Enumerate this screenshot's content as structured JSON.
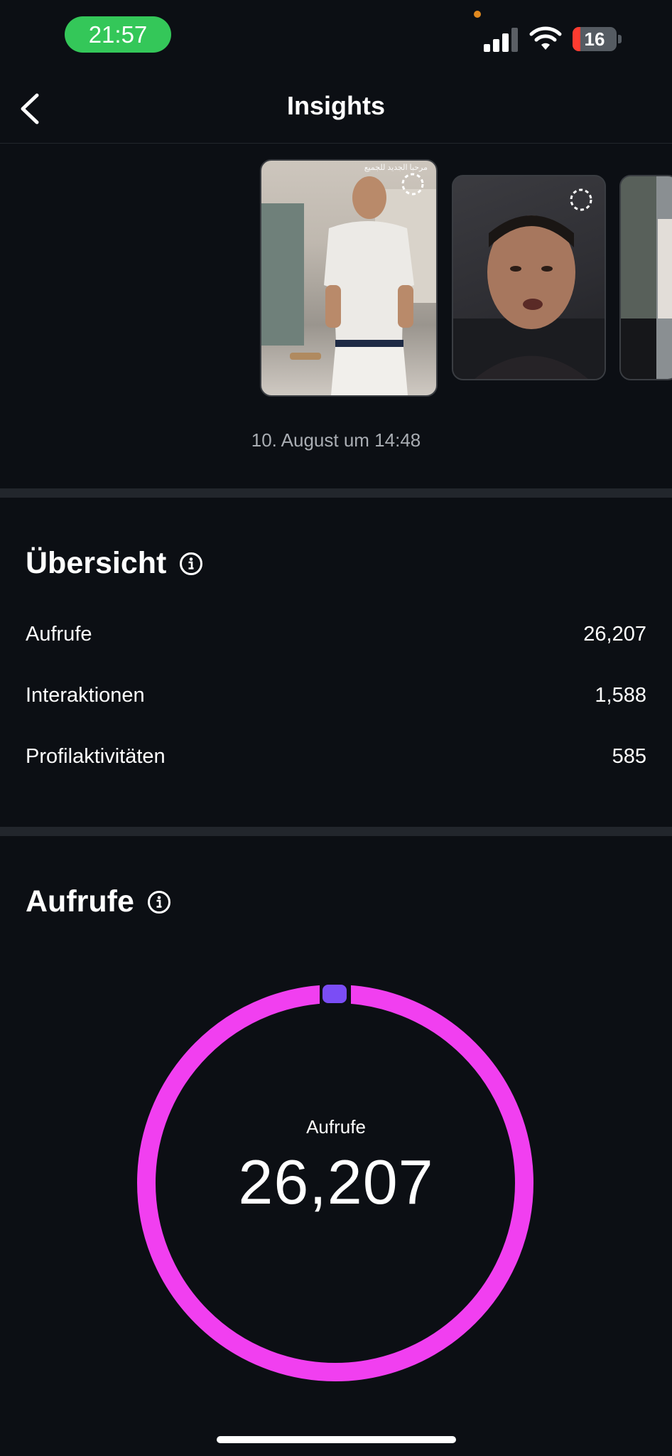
{
  "status_bar": {
    "time": "21:57",
    "battery": "16"
  },
  "header": {
    "title": "Insights"
  },
  "story": {
    "date": "10. August um 14:48"
  },
  "overview": {
    "title": "Übersicht",
    "rows": [
      {
        "label": "Aufrufe",
        "value": "26,207"
      },
      {
        "label": "Interaktionen",
        "value": "1,588"
      },
      {
        "label": "Profilaktivitäten",
        "value": "585"
      }
    ]
  },
  "views": {
    "title": "Aufrufe",
    "donut_label": "Aufrufe",
    "donut_value": "26,207"
  },
  "colors": {
    "accent_pink": "#f13ff0",
    "accent_purple": "#7b4df5",
    "background": "#0c0f14"
  }
}
